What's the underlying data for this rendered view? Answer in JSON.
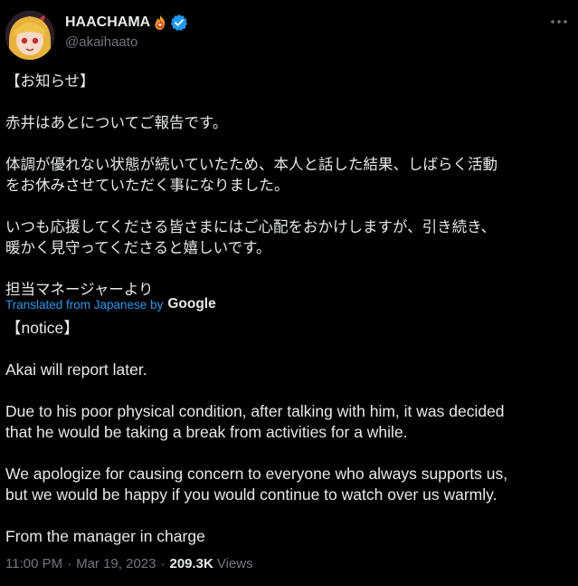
{
  "author": {
    "display_name": "HAACHAMA",
    "handle": "@akaihaato",
    "fire_icon": "fire-heart-emoji",
    "verified_icon": "verified-badge",
    "verified_color": "#1d9bf0"
  },
  "tweet": {
    "original_text": "【お知らせ】\n\n赤井はあとについてご報告です。\n\n体調が優れない状態が続いていたため、本人と話した結果、しばらく活動\nをお休みさせていただく事になりました。\n\nいつも応援してくださる皆さまにはご心配をおかけしますが、引き続き、\n暖かく見守ってくださると嬉しいです。\n\n担当マネージャーより",
    "translated_label": "Translated from Japanese by",
    "translator": "Google",
    "translated_text": "【notice】\n\nAkai will report later.\n\nDue to his poor physical condition, after talking with him, it was decided\nthat he would be taking a break from activities for a while.\n\nWe apologize for causing concern to everyone who always supports us,\nbut we would be happy if you would continue to watch over us warmly.\n\nFrom the manager in charge"
  },
  "meta": {
    "time": "11:00 PM",
    "separator": "·",
    "date": "Mar 19, 2023",
    "views_count": "209.3K",
    "views_label": "Views"
  },
  "colors": {
    "background": "#000000",
    "text": "#e7e9ea",
    "secondary": "#71767b",
    "accent": "#1d9bf0"
  }
}
